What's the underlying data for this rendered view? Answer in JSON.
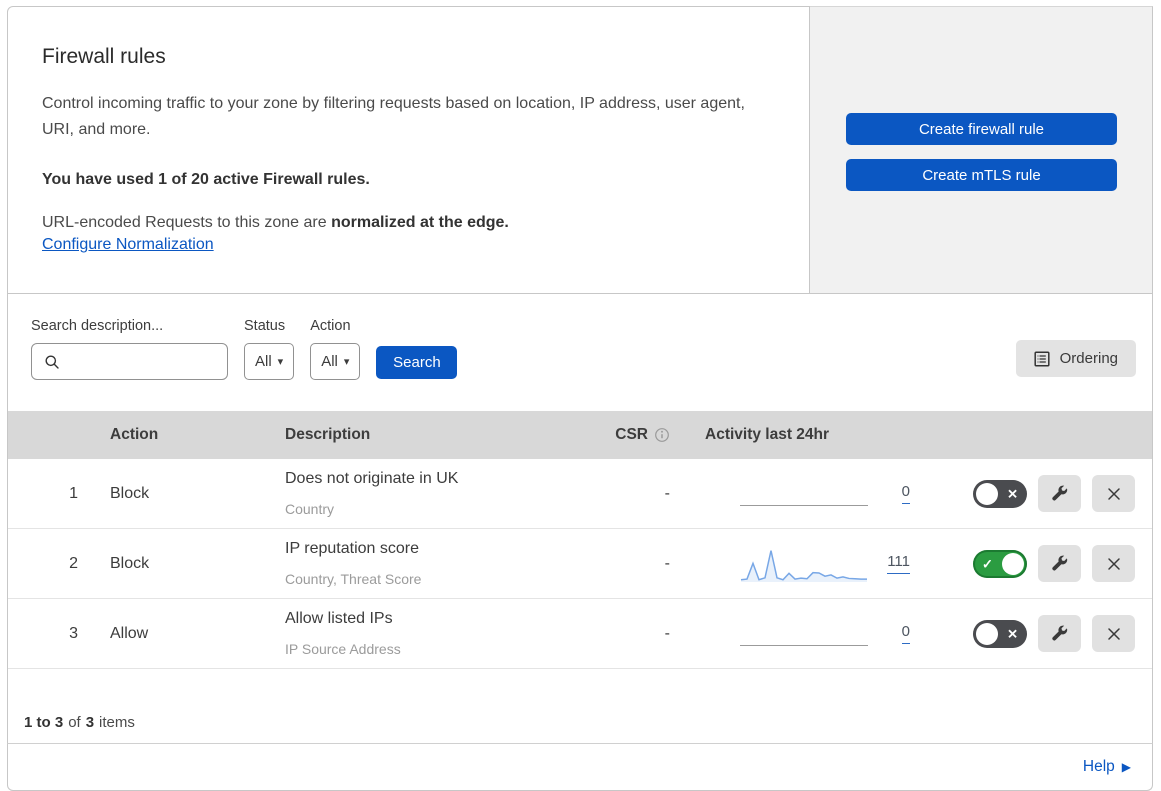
{
  "header": {
    "title": "Firewall rules",
    "description": "Control incoming traffic to your zone by filtering requests based on location, IP address, user agent, URI, and more.",
    "usage": "You have used 1 of 20 active Firewall rules.",
    "normalization_text": "URL-encoded Requests to this zone are ",
    "normalization_bold": "normalized at the edge.",
    "normalization_link": "Configure Normalization",
    "buttons": [
      {
        "label": "Create firewall rule"
      },
      {
        "label": "Create mTLS rule"
      }
    ]
  },
  "filters": {
    "search_label": "Search description...",
    "status_label": "Status",
    "status_value": "All",
    "action_label": "Action",
    "action_value": "All",
    "search_button": "Search",
    "ordering_button": "Ordering"
  },
  "table": {
    "columns": {
      "action": "Action",
      "description": "Description",
      "csr": "CSR",
      "activity": "Activity last 24hr"
    },
    "rows": [
      {
        "num": "1",
        "action": "Block",
        "description": "Does not originate in UK",
        "criteria": "Country",
        "csr": "-",
        "activity_count": "0",
        "enabled": false,
        "sparkline": []
      },
      {
        "num": "2",
        "action": "Block",
        "description": "IP reputation score",
        "criteria": "Country, Threat Score",
        "csr": "-",
        "activity_count": "111",
        "enabled": true,
        "sparkline": [
          4,
          6,
          55,
          4,
          10,
          95,
          10,
          4,
          24,
          6,
          9,
          7,
          26,
          25,
          15,
          19,
          9,
          13,
          8,
          7,
          6,
          6
        ]
      },
      {
        "num": "3",
        "action": "Allow",
        "description": "Allow listed IPs",
        "criteria": "IP Source Address",
        "csr": "-",
        "activity_count": "0",
        "enabled": false,
        "sparkline": []
      }
    ],
    "footer": {
      "range_bold": "1 to 3",
      "of_text": "of",
      "total_bold": "3",
      "items_text": "items"
    }
  },
  "help": {
    "label": "Help"
  },
  "icons": {
    "check": "✓",
    "close": "✕",
    "caret": "▾",
    "help_arrow": "▶"
  },
  "colors": {
    "accent_blue": "#0b57c2",
    "toggle_on_green": "#2b9c41",
    "toggle_off_dark": "#4a4b4f",
    "sparkline_line": "#78a7e6",
    "sparkline_fill": "#e9f1fb",
    "table_header_bg": "#d8d8d8",
    "panel_gray": "#f1f1f1"
  }
}
